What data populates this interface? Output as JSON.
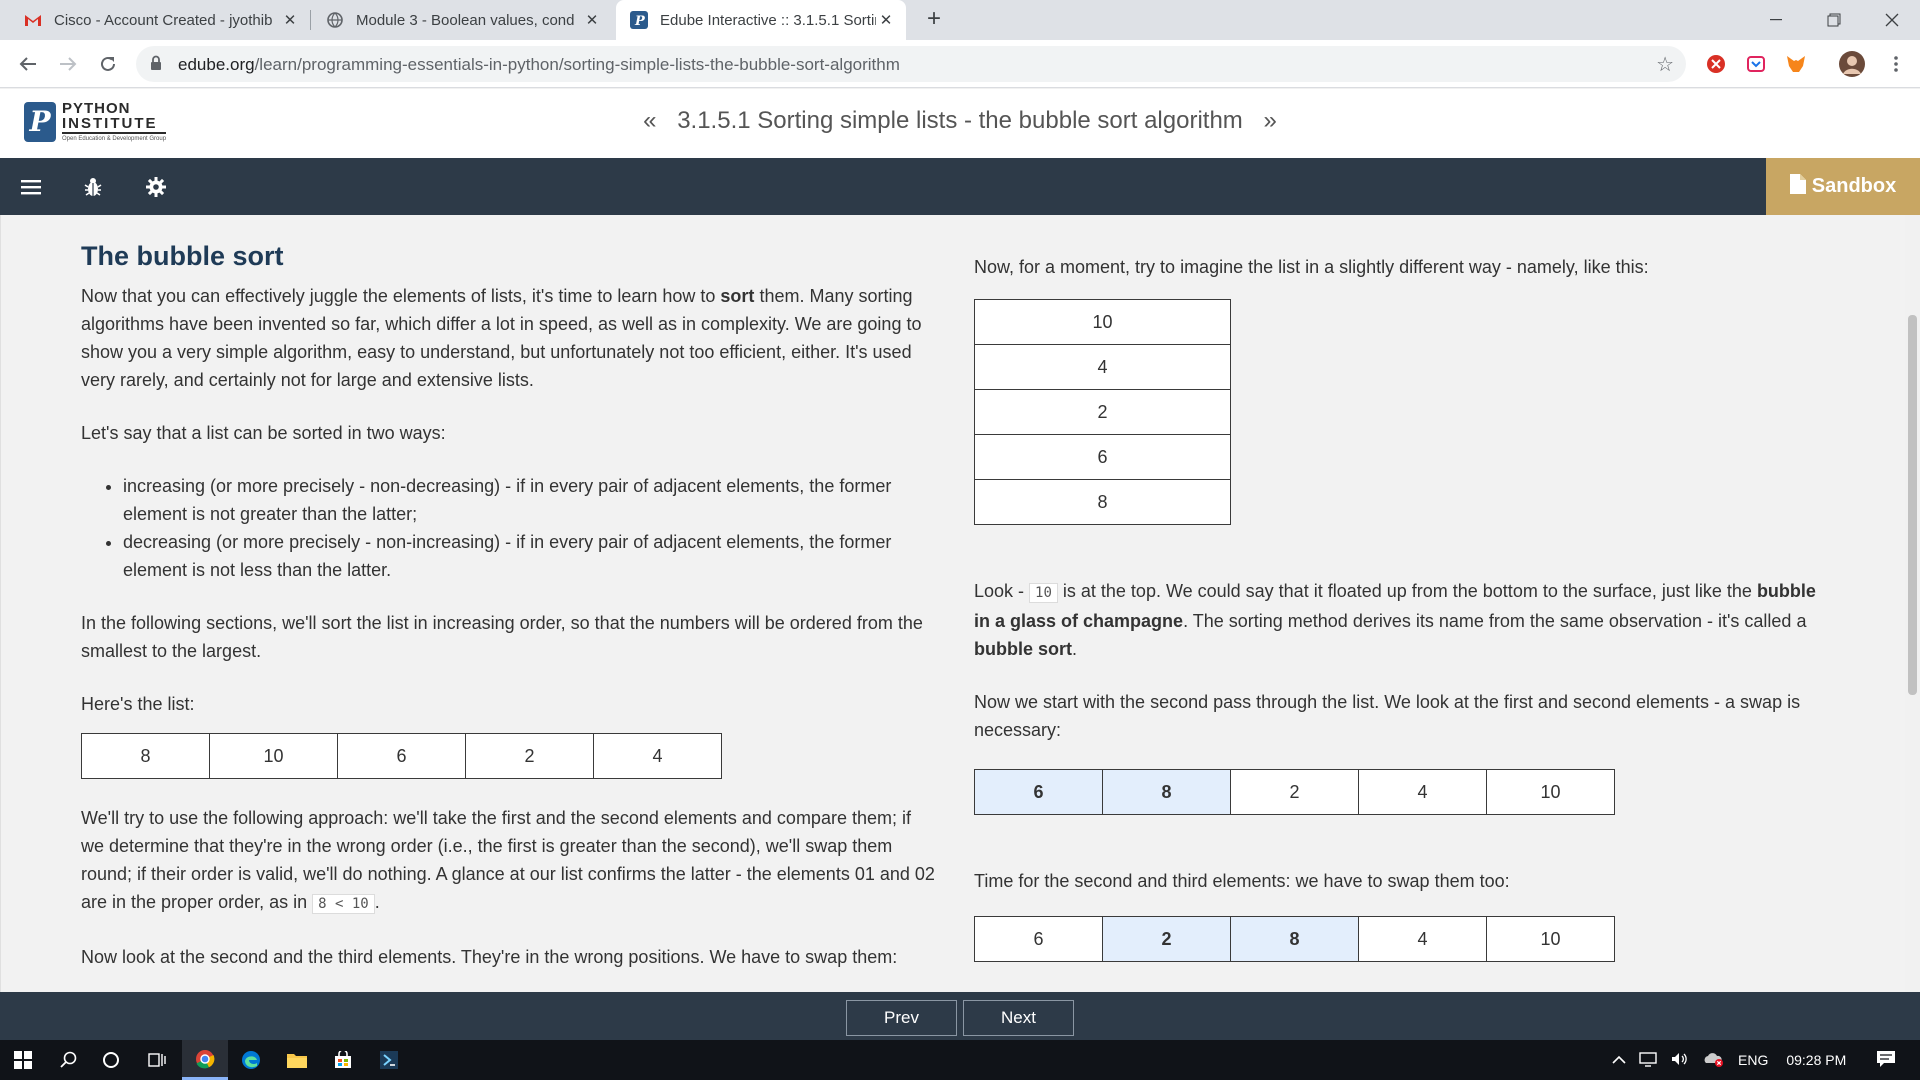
{
  "browser": {
    "tabs": [
      {
        "title": "Cisco - Account Created - jyothib",
        "icon": "gmail-icon",
        "active": false
      },
      {
        "title": "Module 3 - Boolean values, cond",
        "icon": "globe-icon",
        "active": false
      },
      {
        "title": "Edube Interactive :: 3.1.5.1 Sortin",
        "icon": "python-institute-icon",
        "active": true
      }
    ],
    "url_domain": "edube.org",
    "url_path": "/learn/programming-essentials-in-python/sorting-simple-lists-the-bubble-sort-algorithm",
    "close_glyph": "✕",
    "new_tab_glyph": "+"
  },
  "site": {
    "logo_line1": "PYTHON",
    "logo_line2": "INSTITUTE",
    "logo_tagline": "Open Education & Development Group",
    "lesson_title": "3.1.5.1 Sorting simple lists - the bubble sort algorithm",
    "prev_chevron": "«",
    "next_chevron": "»",
    "sandbox_label": "Sandbox"
  },
  "left": {
    "heading": "The bubble sort",
    "p1_before": "Now that you can effectively juggle the elements of lists, it's time to learn how to ",
    "p1_bold": "sort",
    "p1_after": " them. Many sorting algorithms have been invented so far, which differ a lot in speed, as well as in complexity. We are going to show you a very simple algorithm, easy to understand, but unfortunately not too efficient, either. It's used very rarely, and certainly not for large and extensive lists.",
    "p2": "Let's say that a list can be sorted in two ways:",
    "bullets": [
      "increasing (or more precisely - non-decreasing) - if in every pair of adjacent elements, the former element is not greater than the latter;",
      "decreasing (or more precisely - non-increasing) - if in every pair of adjacent elements, the former element is not less than the latter."
    ],
    "p3": "In the following sections, we'll sort the list in increasing order, so that the numbers will be ordered from the smallest to the largest.",
    "p4": "Here's the list:",
    "list1": [
      "8",
      "10",
      "6",
      "2",
      "4"
    ],
    "p5_before": "We'll try to use the following approach: we'll take the first and the second elements and compare them; if we determine that they're in the wrong order (i.e., the first is greater than the second), we'll swap them round; if their order is valid, we'll do nothing. A glance at our list confirms the latter - the elements 01 and 02 are in the proper order, as in ",
    "p5_code": "8 < 10",
    "p5_after": ".",
    "p6": "Now look at the second and the third elements. They're in the wrong positions. We have to swap them:"
  },
  "right": {
    "p1": "Now, for a moment, try to imagine the list in a slightly different way - namely, like this:",
    "vlist": [
      "10",
      "4",
      "2",
      "6",
      "8"
    ],
    "p2_before": "Look - ",
    "p2_code": "10",
    "p2_mid": " is at the top. We could say that it floated up from the bottom to the surface, just like the ",
    "p2_bold1": "bubble in a glass of champagne",
    "p2_mid2": ". The sorting method derives its name from the same observation - it's called a ",
    "p2_bold2": "bubble sort",
    "p2_end": ".",
    "p3": "Now we start with the second pass through the list. We look at the first and second elements - a swap is necessary:",
    "list2": [
      "6",
      "8",
      "2",
      "4",
      "10"
    ],
    "p4": "Time for the second and third elements: we have to swap them too:",
    "list3": [
      "6",
      "2",
      "8",
      "4",
      "10"
    ]
  },
  "pager": {
    "prev": "Prev",
    "next": "Next"
  },
  "taskbar": {
    "lang": "ENG",
    "time": "09:28 PM"
  },
  "colors": {
    "dark_nav": "#2d3a48",
    "sandbox": "#c8a663",
    "highlight_cell": "#e3eefc",
    "heading": "#1f3b57"
  }
}
